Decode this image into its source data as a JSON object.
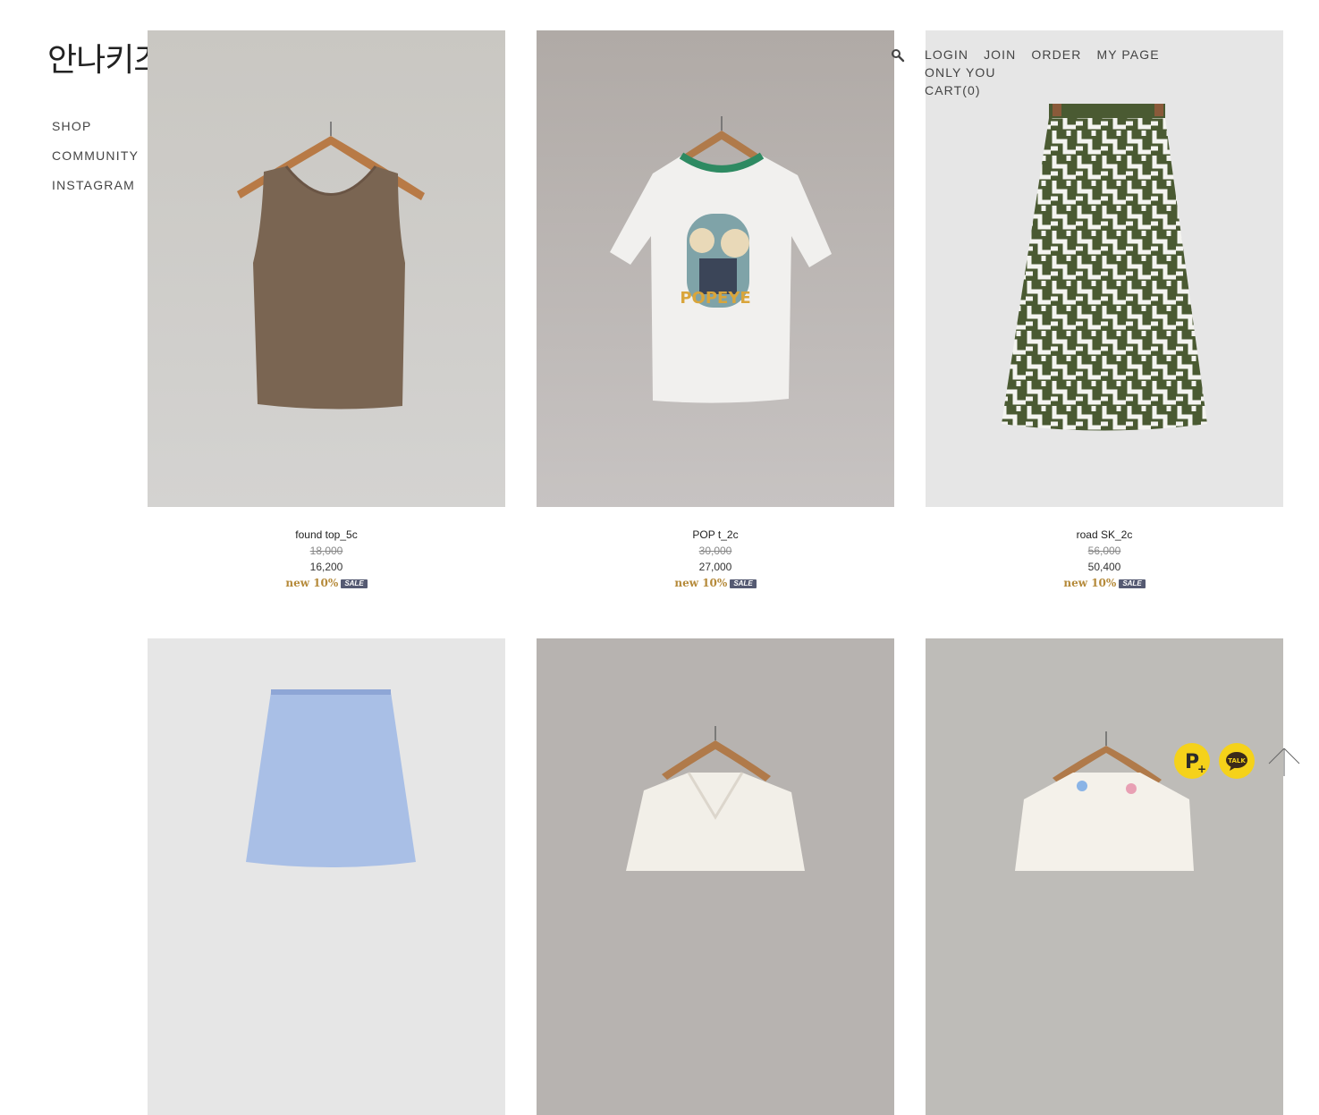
{
  "brand": {
    "logo": "안나키즈"
  },
  "side_nav": [
    {
      "label": "SHOP"
    },
    {
      "label": "COMMUNITY"
    },
    {
      "label": "INSTAGRAM"
    }
  ],
  "top_nav": {
    "search_icon": "search-icon",
    "links": [
      {
        "label": "LOGIN"
      },
      {
        "label": "JOIN"
      },
      {
        "label": "ORDER"
      },
      {
        "label": "MY PAGE"
      },
      {
        "label": "ONLY YOU"
      },
      {
        "label": "CART(0)"
      }
    ]
  },
  "products": [
    {
      "name": "found top_5c",
      "original_price": "18,000",
      "price": "16,200",
      "tag": "new 10%",
      "badge": "SALE",
      "image": "brown-tank-top"
    },
    {
      "name": "POP t_2c",
      "original_price": "30,000",
      "price": "27,000",
      "tag": "new 10%",
      "badge": "SALE",
      "image": "white-popeye-tshirt"
    },
    {
      "name": "road SK_2c",
      "original_price": "56,000",
      "price": "50,400",
      "tag": "new 10%",
      "badge": "SALE",
      "image": "green-pattern-skirt"
    },
    {
      "image": "blue-skirt"
    },
    {
      "image": "white-lace-blouse"
    },
    {
      "image": "embroidered-collar-blouse"
    }
  ],
  "floating": {
    "plus_friend_icon": "plus-friend-icon",
    "talk_label": "TALK",
    "scroll_top_icon": "arrow-up-icon"
  },
  "colors": {
    "sale_badge": "#555a72",
    "new_tag": "#b58a3a",
    "kakao_yellow": "#f5d21a"
  }
}
